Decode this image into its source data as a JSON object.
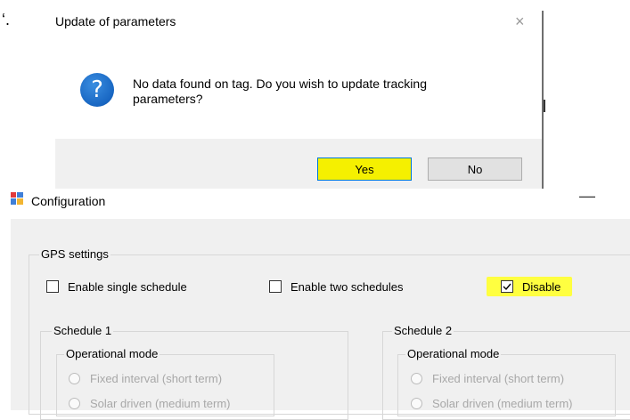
{
  "fragment": "‘.",
  "dialog": {
    "title": "Update of parameters",
    "close_glyph": "×",
    "icon_glyph": "?",
    "message_line1": "No data found on tag. Do you wish to update tracking",
    "message_line2": "parameters?",
    "yes_label": "Yes",
    "no_label": "No"
  },
  "configuration": {
    "title": "Configuration",
    "minimize_glyph": "—",
    "gps_settings_label": "GPS settings",
    "enable_single_label": "Enable single schedule",
    "enable_two_label": "Enable two schedules",
    "disable_label": "Disable",
    "disable_checked": true,
    "schedule1": {
      "label": "Schedule 1",
      "operational_mode_label": "Operational mode",
      "options": [
        "Fixed interval (short term)",
        "Solar driven (medium term)"
      ]
    },
    "schedule2": {
      "label": "Schedule 2",
      "operational_mode_label": "Operational mode",
      "options": [
        "Fixed interval (short term)",
        "Solar driven (medium term)"
      ]
    }
  },
  "colors": {
    "highlight": "#f5f000",
    "accent_border": "#0078d7",
    "icon_blue": "#1866c2"
  }
}
